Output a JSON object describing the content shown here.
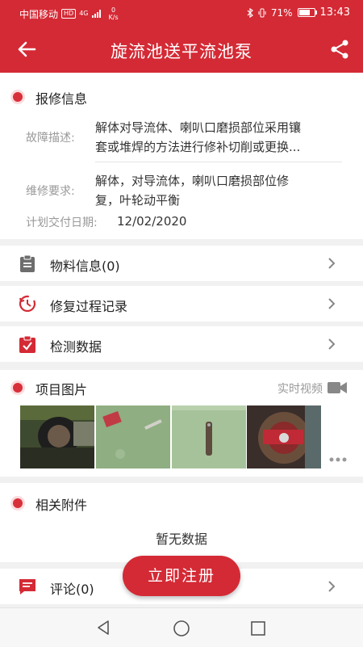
{
  "status_bar": {
    "carrier": "中国移动",
    "hd": "HD",
    "net_type": "4G",
    "speed_value": "0",
    "speed_unit": "K/s",
    "battery": "71%",
    "time": "13:43"
  },
  "header": {
    "title": "旋流池送平流池泵"
  },
  "repair_info": {
    "section_title": "报修信息",
    "fault_label": "故障描述:",
    "fault_line1": "解体对导流体、喇叭口磨损部位采用镶",
    "fault_line2": "套或堆焊的方法进行修补切削或更换...",
    "req_label": "维修要求:",
    "req_line1": "解体，对导流体，喇叭口磨损部位修",
    "req_line2": "复，叶轮动平衡",
    "date_label": "计划交付日期:",
    "date_value": "12/02/2020"
  },
  "rows": {
    "material": "物料信息(0)",
    "process": "修复过程记录",
    "inspection": "检测数据",
    "comment": "评论(0)"
  },
  "images": {
    "section_title": "项目图片",
    "video_link": "实时视频"
  },
  "attachments": {
    "section_title": "相关附件",
    "empty_text": "暂无数据"
  },
  "fab": {
    "label": "立即注册"
  },
  "colors": {
    "accent": "#d42a35"
  },
  "icons": [
    "back-arrow-icon",
    "share-icon",
    "clipboard-icon",
    "history-icon",
    "checklist-icon",
    "video-camera-icon",
    "comment-icon",
    "chevron-right-icon",
    "more-icon"
  ]
}
